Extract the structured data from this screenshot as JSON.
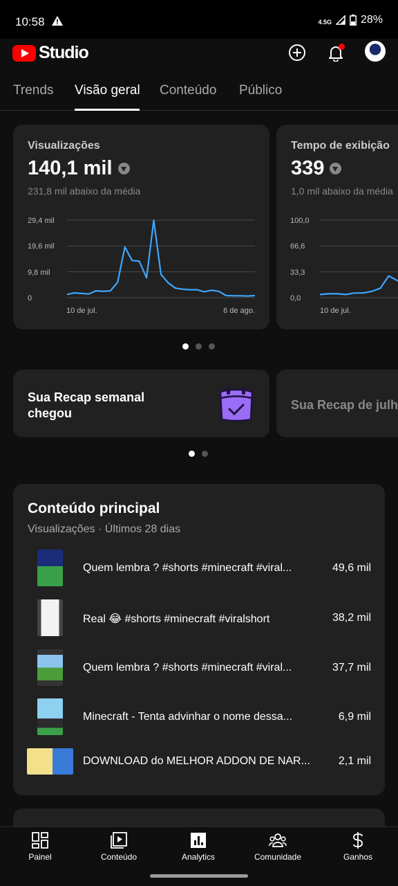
{
  "status": {
    "time": "10:58",
    "network": "4.5G",
    "battery": "28%"
  },
  "app": {
    "logo_text": "Studio",
    "icons": [
      "create-icon",
      "notifications-icon",
      "avatar"
    ]
  },
  "tabs": [
    {
      "label": "Trends",
      "active": false
    },
    {
      "label": "Visão geral",
      "active": true
    },
    {
      "label": "Conteúdo",
      "active": false
    },
    {
      "label": "Público",
      "active": false
    }
  ],
  "kpis": [
    {
      "title": "Visualizações",
      "value": "140,1 mil",
      "sub": "231,8 mil abaixo da média",
      "y_ticks": [
        "29,4 mil",
        "19,6 mil",
        "9,8 mil",
        "0"
      ],
      "x_start": "10 de jul.",
      "x_end": "6 de ago."
    },
    {
      "title": "Tempo de exibição",
      "value": "339",
      "sub": "1,0 mil abaixo da média",
      "y_ticks": [
        "100,0",
        "66,6",
        "33,3",
        "0,0"
      ],
      "x_start": "10 de jul."
    }
  ],
  "chart_data": [
    {
      "type": "line",
      "title": "Visualizações",
      "x_range": [
        "10 de jul.",
        "6 de ago."
      ],
      "ylim": [
        0,
        29400
      ],
      "yticks": [
        0,
        9800,
        19600,
        29400
      ],
      "values": [
        1200,
        1800,
        1600,
        1400,
        2600,
        2400,
        2600,
        5800,
        19200,
        14100,
        13800,
        7500,
        29300,
        8800,
        5600,
        3600,
        3200,
        3000,
        3000,
        2200,
        2800,
        2400,
        800,
        700,
        700,
        600,
        800
      ],
      "color": "#3ea6ff"
    },
    {
      "type": "line",
      "title": "Tempo de exibição",
      "ylim": [
        0,
        100
      ],
      "yticks": [
        0,
        33.3,
        66.6,
        100
      ],
      "values": [
        4,
        5,
        5,
        4,
        6,
        6,
        8,
        12,
        28,
        22,
        19,
        25
      ],
      "color": "#3ea6ff"
    }
  ],
  "carousel1": {
    "dots": 3,
    "active": 0
  },
  "recaps": [
    {
      "title": "Sua Recap semanal chegou",
      "line1": "Sua Recap semanal",
      "line2": "chegou"
    },
    {
      "title": "Sua Recap de julho",
      "line1": "Sua Recap de julh"
    }
  ],
  "carousel2": {
    "dots": 2,
    "active": 0
  },
  "top_content": {
    "title": "Conteúdo principal",
    "subtitle": "Visualizações · Últimos 28 dias",
    "items": [
      {
        "title": "Quem lembra ? #shorts #minecraft #viral...",
        "views": "49,6 mil"
      },
      {
        "title": "Real 😂 #shorts #minecraft #viralshort",
        "views": "38,2 mil"
      },
      {
        "title": "Quem lembra ? #shorts #minecraft #viral...",
        "views": "37,7 mil"
      },
      {
        "title": "Minecraft - Tenta advinhar o nome dessa...",
        "views": "6,9 mil"
      },
      {
        "title": "DOWNLOAD do MELHOR ADDON DE NAR...",
        "views": "2,1 mil"
      }
    ]
  },
  "nav": [
    {
      "label": "Painel",
      "icon": "dashboard-icon"
    },
    {
      "label": "Conteúdo",
      "icon": "content-icon"
    },
    {
      "label": "Analytics",
      "icon": "analytics-icon"
    },
    {
      "label": "Comunidade",
      "icon": "community-icon"
    },
    {
      "label": "Ganhos",
      "icon": "earnings-icon"
    }
  ]
}
